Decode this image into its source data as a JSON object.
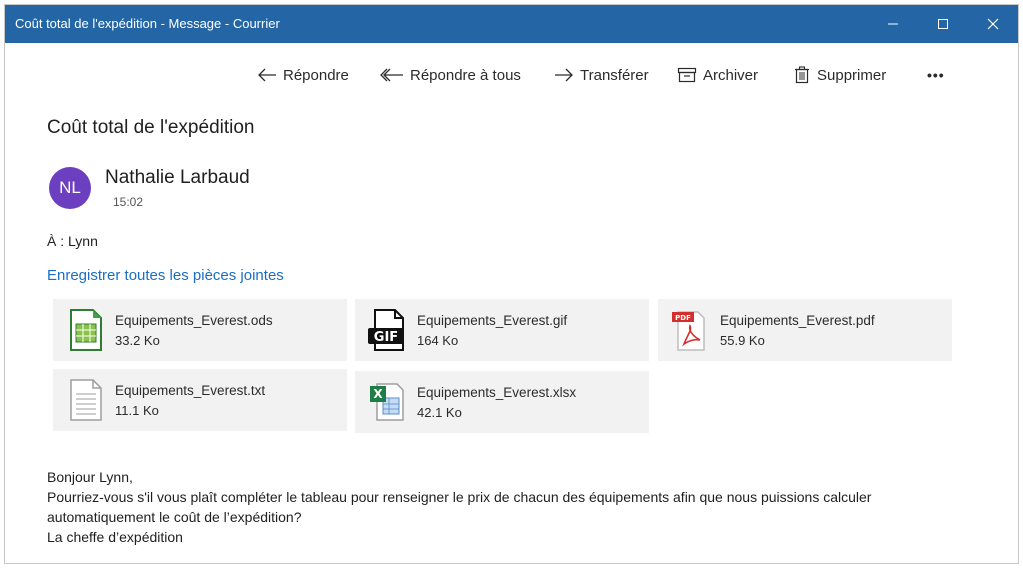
{
  "window": {
    "title": "Coût total de l'expédition - Message - Courrier"
  },
  "toolbar": {
    "reply": "Répondre",
    "reply_all": "Répondre à tous",
    "forward": "Transférer",
    "archive": "Archiver",
    "delete": "Supprimer",
    "more": "•••"
  },
  "message": {
    "subject": "Coût total de l'expédition",
    "avatar_initials": "NL",
    "sender": "Nathalie Larbaud",
    "time": "15:02",
    "to_label": "À :",
    "to": "Lynn",
    "save_all": "Enregistrer toutes les pièces jointes",
    "body": [
      "Bonjour Lynn,",
      "Pourriez-vous s'il vous plaît compléter le tableau pour renseigner le prix de chacun des équipements afin que nous puissions calculer",
      "automatiquement le coût de l’expédition?",
      "La cheffe d’expédition"
    ]
  },
  "attachments": [
    {
      "name": "Equipements_Everest.ods",
      "size": "33.2 Ko",
      "icon": "spreadsheet-ods-icon"
    },
    {
      "name": "Equipements_Everest.gif",
      "size": "164 Ko",
      "icon": "gif-file-icon"
    },
    {
      "name": "Equipements_Everest.pdf",
      "size": "55.9 Ko",
      "icon": "pdf-file-icon"
    },
    {
      "name": "Equipements_Everest.txt",
      "size": "11.1 Ko",
      "icon": "text-file-icon"
    },
    {
      "name": "Equipements_Everest.xlsx",
      "size": "42.1 Ko",
      "icon": "excel-file-icon"
    }
  ],
  "colors": {
    "titlebar": "#2466a5",
    "avatar": "#6b3fbf",
    "link": "#1b6ec2",
    "attachment_bg": "#f2f2f2"
  }
}
